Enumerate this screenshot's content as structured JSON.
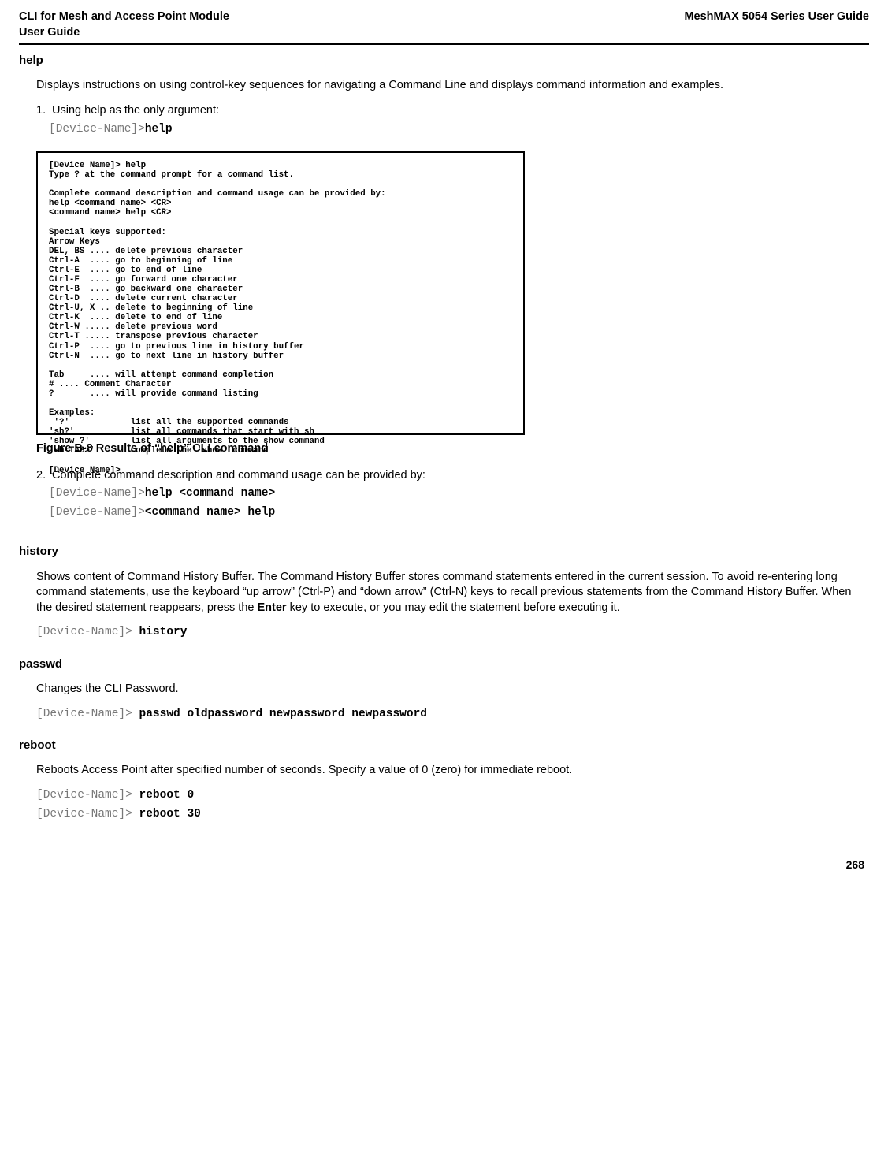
{
  "header": {
    "left_l1": "CLI for Mesh and Access Point Module",
    "left_l2": " User Guide",
    "right": "MeshMAX 5054 Series User Guide"
  },
  "help": {
    "title": "help",
    "intro": "Displays instructions on using control-key sequences for navigating a Command Line and displays command information and examples.",
    "ol1_num": "1.",
    "ol1_text": "Using help as the only argument:",
    "ol1_prompt": "[Device-Name]>",
    "ol1_cmd": "help",
    "fig_text": "[Device Name]> help\nType ? at the command prompt for a command list.\n\nComplete command description and command usage can be provided by:\nhelp <command name> <CR>\n<command name> help <CR>\n\nSpecial keys supported:\nArrow Keys\nDEL, BS .... delete previous character\nCtrl-A  .... go to beginning of line\nCtrl-E  .... go to end of line\nCtrl-F  .... go forward one character\nCtrl-B  .... go backward one character\nCtrl-D  .... delete current character\nCtrl-U, X .. delete to beginning of line\nCtrl-K  .... delete to end of line\nCtrl-W ..... delete previous word\nCtrl-T ..... transpose previous character\nCtrl-P  .... go to previous line in history buffer\nCtrl-N  .... go to next line in history buffer\n\nTab     .... will attempt command completion\n# .... Comment Character\n?       .... will provide command listing\n\nExamples:\n '?'            list all the supported commands\n'sh?'           list all commands that start with sh\n'show ?'        list all arguments to the show command\n'sh<TAB>'       complete the 'show' command\n\n[Device Name]>",
    "fig_caption": "Figure B-8 Results of “help” CLI command",
    "ol2_num": "2.",
    "ol2_text": "Complete command description and command usage can be provided by:",
    "ol2_prompt_a": "[Device-Name]>",
    "ol2_cmd_a": "help <command name>",
    "ol2_prompt_b": "[Device-Name]>",
    "ol2_cmd_b": "<command name> help"
  },
  "history": {
    "title": "history",
    "body_a": "Shows content of Command History Buffer. The Command History Buffer stores command statements entered in the current session. To avoid re-entering long command statements, use the keyboard “up arrow” (Ctrl-P) and “down arrow” (Ctrl-N) keys to recall previous statements from the Command History Buffer. When the desired statement reappears, press the ",
    "enter": "Enter",
    "body_b": " key to execute, or you may edit the statement before executing it.",
    "prompt": "[Device-Name]>",
    "cmd": " history"
  },
  "passwd": {
    "title": "passwd",
    "body": "Changes the CLI Password.",
    "prompt": "[Device-Name]>",
    "cmd": " passwd oldpassword newpassword newpassword"
  },
  "reboot": {
    "title": "reboot",
    "body": "Reboots Access Point after specified number of seconds. Specify a value of 0 (zero) for immediate reboot.",
    "prompt_a": "[Device-Name]>",
    "cmd_a": " reboot 0",
    "prompt_b": "[Device-Name]>",
    "cmd_b": " reboot 30"
  },
  "footer": {
    "page": "268"
  }
}
